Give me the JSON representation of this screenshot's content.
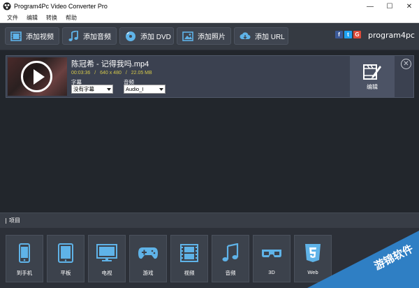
{
  "window": {
    "title": "Program4Pc Video Converter Pro",
    "controls": [
      "—",
      "☐",
      "✕"
    ]
  },
  "menu": [
    "文件",
    "编辑",
    "转换",
    "帮助"
  ],
  "toolbar": {
    "add_video": "添加视频",
    "add_audio": "添加音频",
    "add_dvd": "添加 DVD",
    "add_photo": "添加照片",
    "add_url": "添加 URL",
    "social": [
      "f",
      "t",
      "G"
    ],
    "brand": "program4pc"
  },
  "file_item": {
    "name": "陈冠希 - 记得我吗.mp4",
    "duration": "00:03:36",
    "resolution": "640 x 480",
    "size": "22.05 MB",
    "subtitle_label": "字幕",
    "subtitle_value": "没有字幕",
    "audio_label": "音频",
    "audio_value": "Audio_I",
    "edit_label": "编辑",
    "sep": "/"
  },
  "project": {
    "label": "项目"
  },
  "presets": [
    {
      "icon": "phone-icon",
      "label": "到手机"
    },
    {
      "icon": "tablet-icon",
      "label": "平板"
    },
    {
      "icon": "tv-icon",
      "label": "电视"
    },
    {
      "icon": "gamepad-icon",
      "label": "游戏"
    },
    {
      "icon": "film-icon",
      "label": "视频"
    },
    {
      "icon": "music-icon",
      "label": "音频"
    },
    {
      "icon": "3d-glasses-icon",
      "label": "3D"
    },
    {
      "icon": "html5-icon",
      "label": "Web"
    }
  ],
  "watermark": {
    "text": "游锦软件"
  },
  "colors": {
    "accent_yellow": "#d4c84a",
    "facebook": "#3b5998",
    "twitter": "#1da1f2",
    "google": "#dd4b39",
    "watermark_blue": "#2f7fc4"
  }
}
